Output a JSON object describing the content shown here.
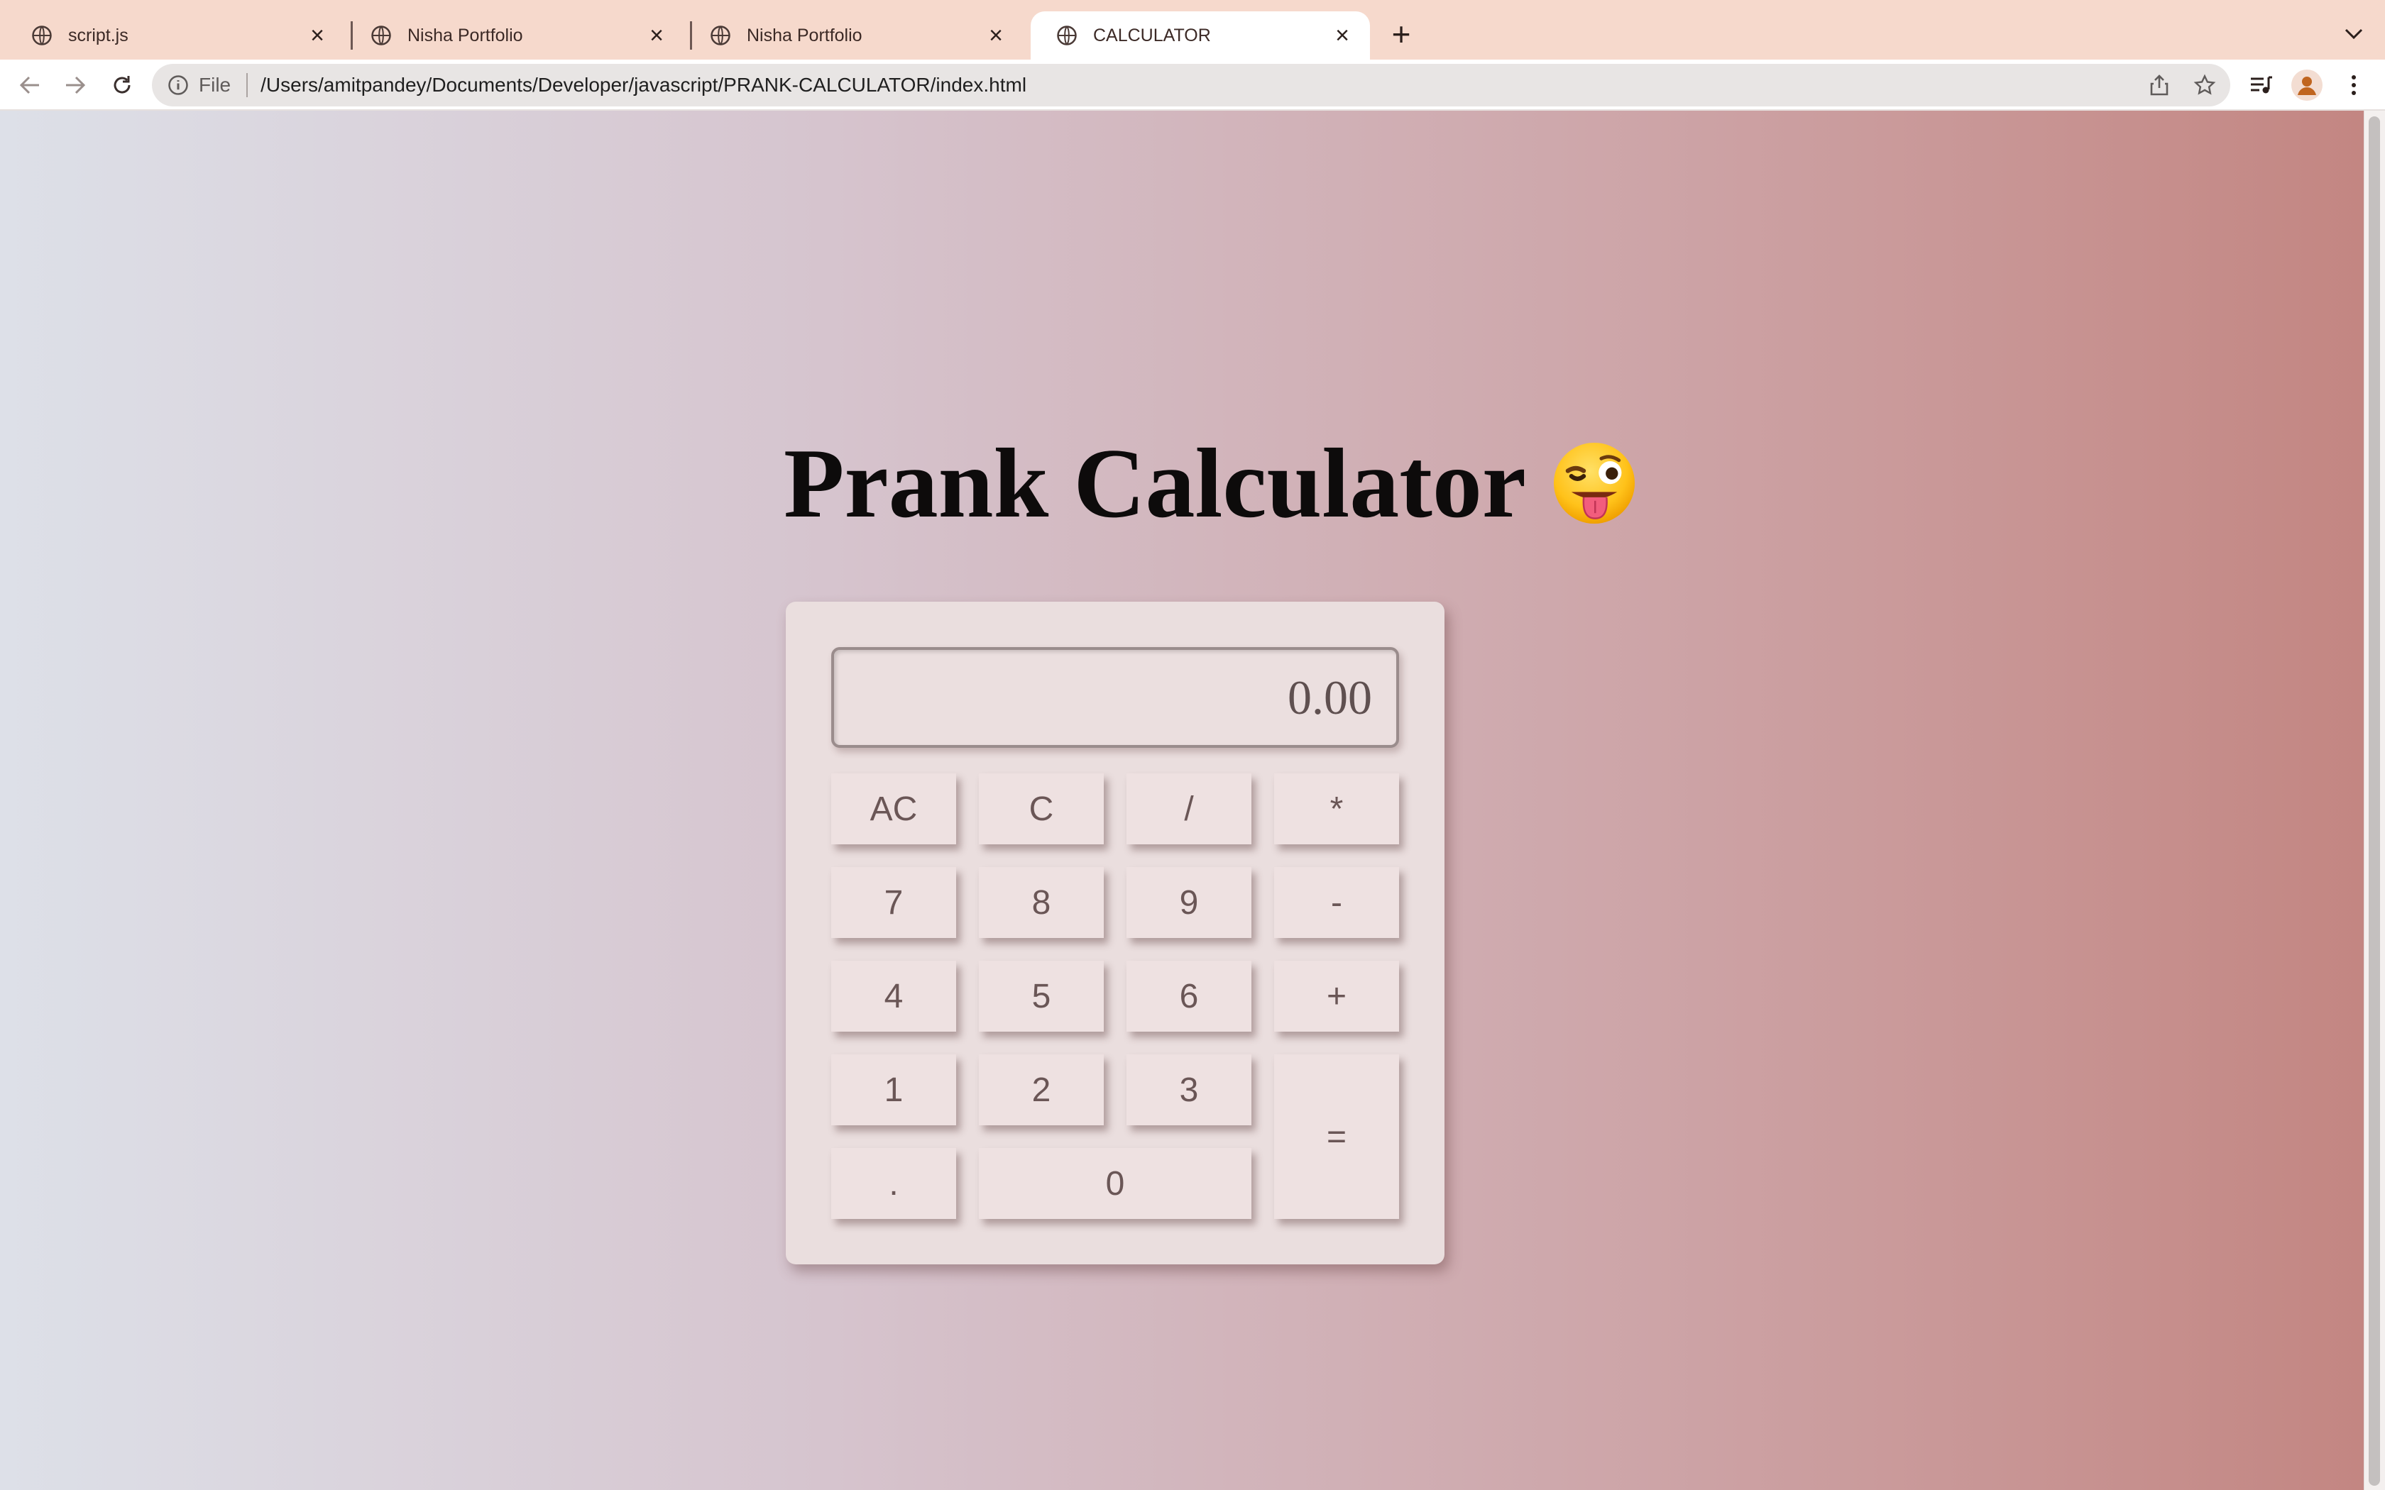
{
  "browser": {
    "tabs": [
      {
        "title": "script.js",
        "active": false
      },
      {
        "title": "Nisha Portfolio",
        "active": false
      },
      {
        "title": "Nisha Portfolio",
        "active": false
      },
      {
        "title": "CALCULATOR",
        "active": true
      }
    ],
    "address_scheme": "File",
    "address_url": "/Users/amitpandey/Documents/Developer/javascript/PRANK-CALCULATOR/index.html"
  },
  "page": {
    "heading": "Prank Calculator",
    "heading_emoji": "winking-face-with-tongue",
    "display_value": "0.00",
    "keys": {
      "ac": "AC",
      "c": "C",
      "divide": "/",
      "multiply": "*",
      "seven": "7",
      "eight": "8",
      "nine": "9",
      "minus": "-",
      "four": "4",
      "five": "5",
      "six": "6",
      "plus": "+",
      "one": "1",
      "two": "2",
      "three": "3",
      "equals": "=",
      "dot": ".",
      "zero": "0"
    }
  },
  "colors": {
    "tabbar": "#f6d9cc",
    "gradient_left": "#dde0e8",
    "gradient_right": "#c38682",
    "calculator_body": "#eadede",
    "key_text": "#6a5656"
  }
}
